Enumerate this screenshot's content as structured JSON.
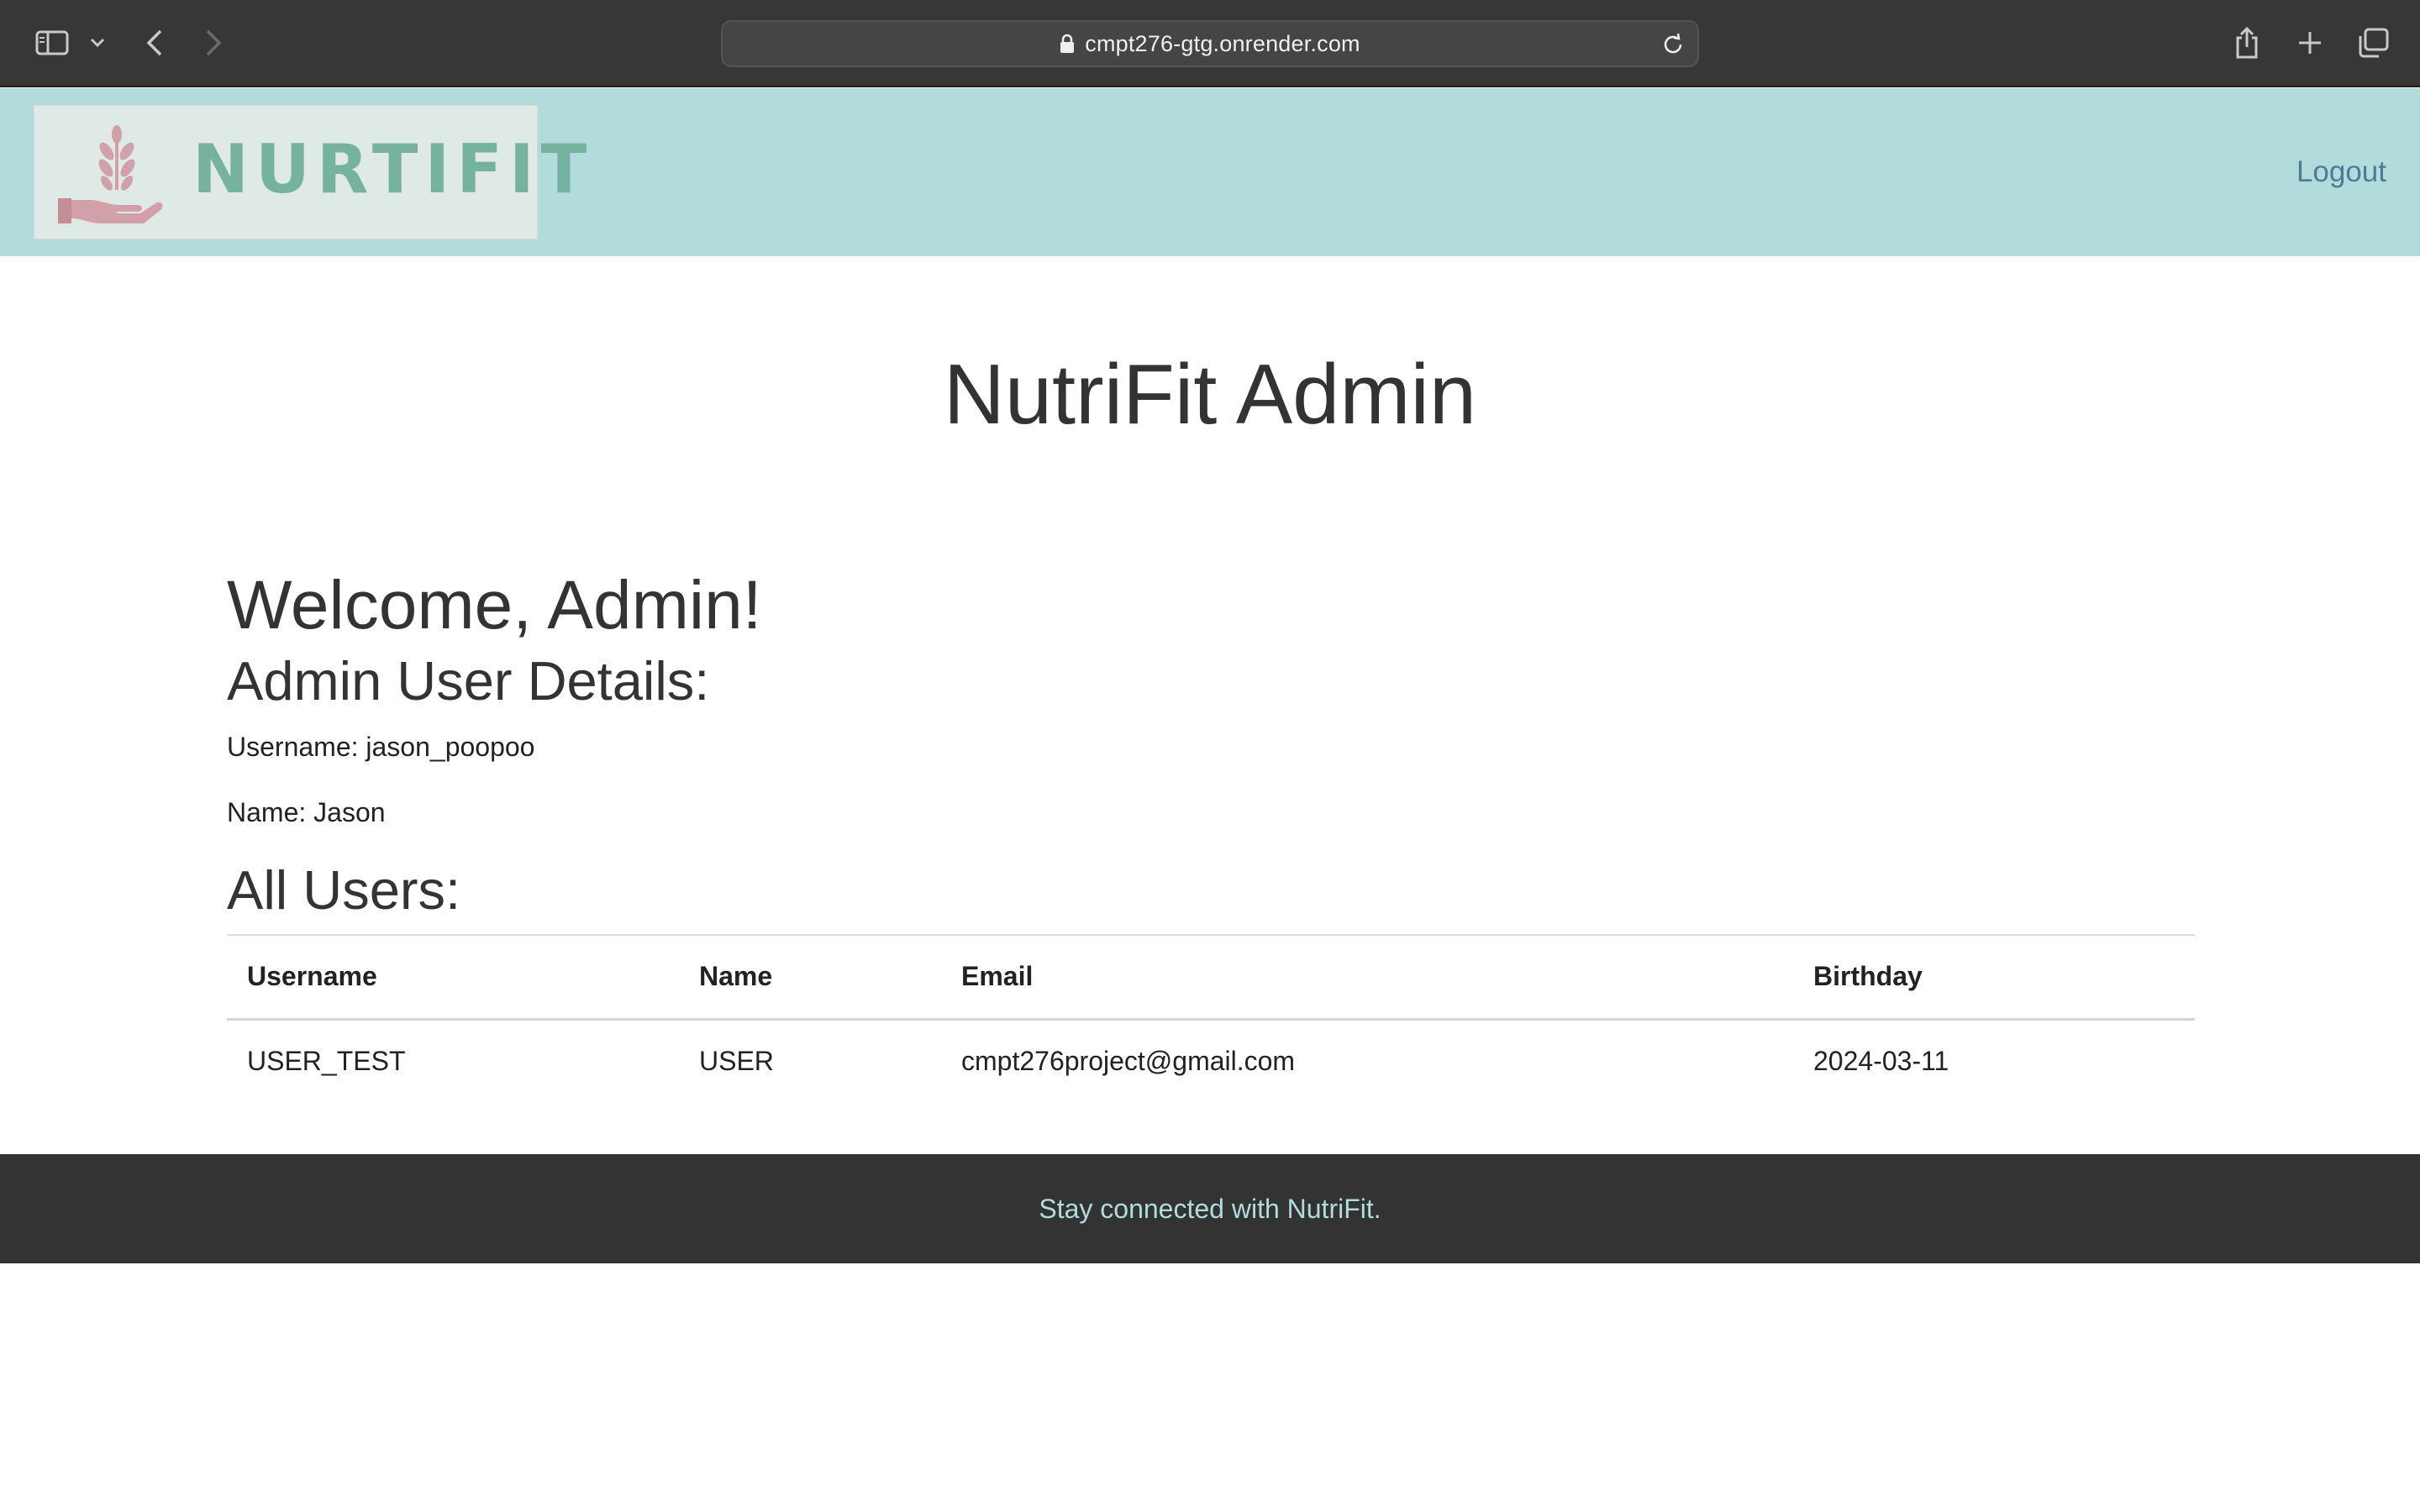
{
  "browser": {
    "url": "cmpt276-gtg.onrender.com",
    "icons": [
      "sidebar-icon",
      "chevron-down-icon",
      "back-arrow-icon",
      "forward-arrow-icon",
      "lock-icon",
      "reload-icon",
      "share-icon",
      "plus-icon",
      "tabs-overview-icon"
    ]
  },
  "header": {
    "logo_text": "NURTIFIT",
    "logout_label": "Logout",
    "background": "#b2dcdc"
  },
  "main": {
    "title": "NutriFit Admin",
    "welcome": "Welcome, Admin!",
    "details_heading": "Admin User Details:",
    "username_line": "Username: jason_poopoo",
    "name_line": "Name: Jason",
    "users_heading": "All Users:"
  },
  "users_table": {
    "columns": [
      "Username",
      "Name",
      "Email",
      "Birthday"
    ],
    "rows": [
      [
        "USER_TEST",
        "USER",
        "cmpt276project@gmail.com",
        "2024-03-11"
      ]
    ]
  },
  "footer": {
    "text": "Stay connected with NutriFit.",
    "background": "#333333"
  }
}
